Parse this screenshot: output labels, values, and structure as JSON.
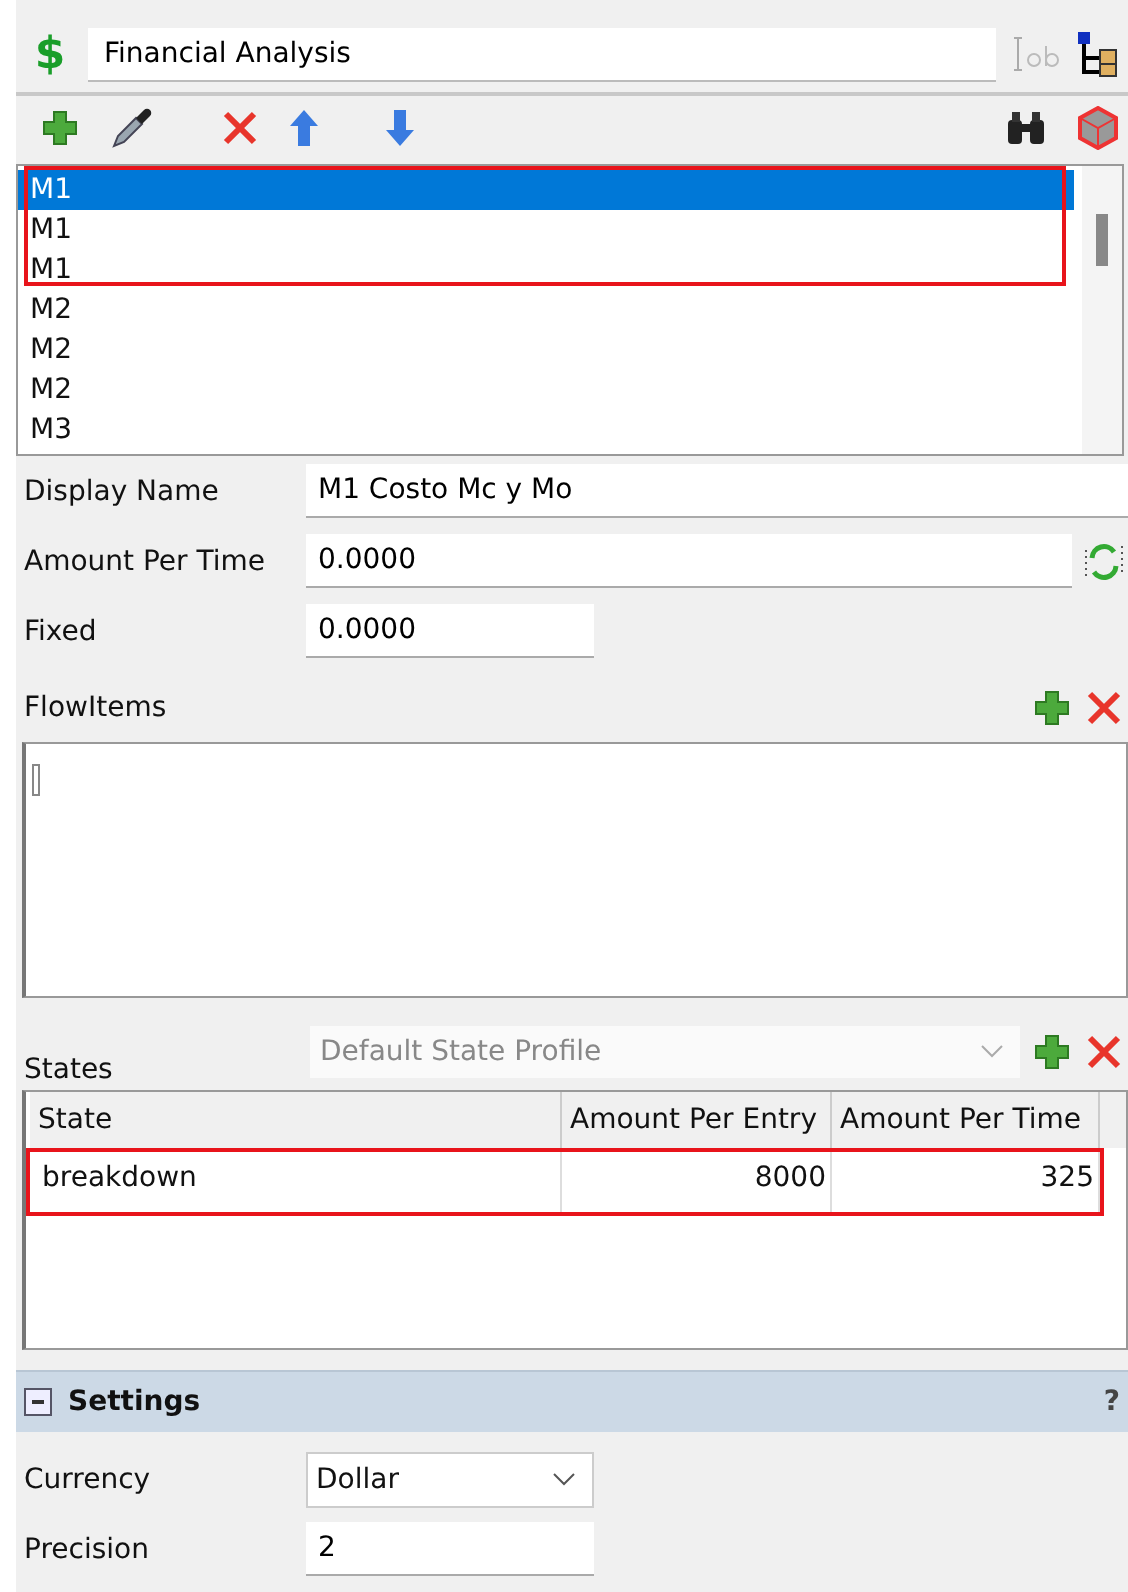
{
  "header": {
    "icon_glyph": "$",
    "name": "Financial Analysis"
  },
  "list": {
    "items": [
      {
        "label": "M1",
        "selected": true,
        "marked": true
      },
      {
        "label": "M1",
        "selected": false,
        "marked": true
      },
      {
        "label": "M1",
        "selected": false,
        "marked": true
      },
      {
        "label": "M2",
        "selected": false,
        "marked": false
      },
      {
        "label": "M2",
        "selected": false,
        "marked": false
      },
      {
        "label": "M2",
        "selected": false,
        "marked": false
      },
      {
        "label": "M3",
        "selected": false,
        "marked": false
      }
    ]
  },
  "fields": [
    {
      "label": "Display Name",
      "value": "M1 Costo Mc y Mo",
      "kind": "full"
    },
    {
      "label": "Amount Per Time",
      "value": "0.0000",
      "kind": "wide"
    },
    {
      "label": "Fixed",
      "value": "0.0000",
      "kind": "short"
    }
  ],
  "flowitems": {
    "label": "FlowItems"
  },
  "states": {
    "label": "States",
    "profile": "Default State Profile",
    "disabled": true,
    "columns": [
      "State",
      "Amount Per Entry",
      "Amount Per Time"
    ],
    "rows": [
      {
        "cells": [
          "breakdown",
          "8000",
          "325"
        ],
        "marked": true
      }
    ]
  },
  "settings": {
    "title": "Settings",
    "expanded": true,
    "help": "?",
    "fields": [
      {
        "label": "Currency",
        "value": "Dollar",
        "kind": "dropdown"
      },
      {
        "label": "Precision",
        "value": "2",
        "kind": "text"
      }
    ]
  }
}
